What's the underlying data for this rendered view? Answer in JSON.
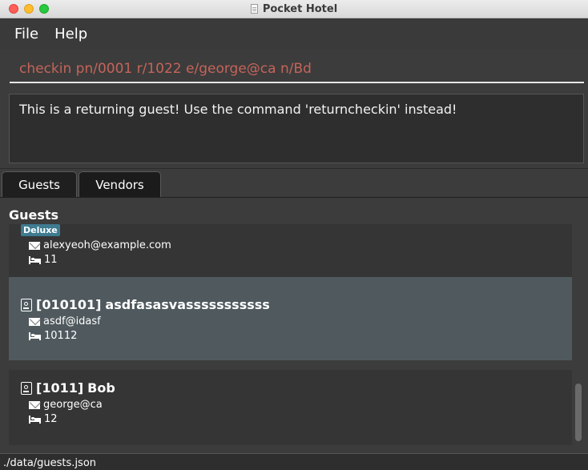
{
  "window": {
    "title": "Pocket Hotel",
    "title_icon": "document-icon"
  },
  "menu": {
    "file": "File",
    "help": "Help"
  },
  "command": {
    "value": "checkin pn/0001 r/1022 e/george@ca n/Bd"
  },
  "result": {
    "message": "This is a returning guest! Use the command 'returncheckin' instead!"
  },
  "tabs": [
    {
      "label": "Guests",
      "selected": true
    },
    {
      "label": "Vendors",
      "selected": false
    }
  ],
  "panel": {
    "title": "Guests"
  },
  "guests": [
    {
      "badge": "Deluxe",
      "email": "alexyeoh@example.com",
      "room": "11"
    },
    {
      "id": "[010101]",
      "name": "asdfasasvasssssssssss",
      "email": "asdf@idasf",
      "room": "10112",
      "selected": true
    },
    {
      "id": "[1011]",
      "name": "Bob",
      "email": "george@ca",
      "room": "12"
    }
  ],
  "status": {
    "path": "./data/guests.json"
  },
  "colors": {
    "command_text": "#c5645a",
    "badge": "#3e7b91",
    "selected_card": "#505a5e"
  }
}
